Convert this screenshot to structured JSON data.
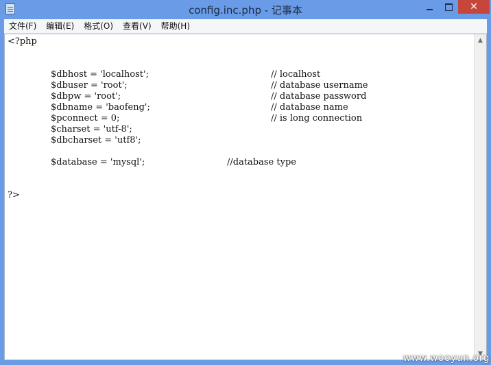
{
  "window": {
    "title": "config.inc.php - 记事本",
    "close_glyph": "✕"
  },
  "menu": [
    {
      "label": "文件(F)"
    },
    {
      "label": "编辑(E)"
    },
    {
      "label": "格式(O)"
    },
    {
      "label": "查看(V)"
    },
    {
      "label": "帮助(H)"
    }
  ],
  "editor": {
    "open_tag": "<?php",
    "lines": [
      {
        "code": "$dbhost = 'localhost';",
        "comment": "// localhost"
      },
      {
        "code": "$dbuser = 'root';",
        "comment": "// database username"
      },
      {
        "code": "$dbpw = 'root';",
        "comment": "// database password"
      },
      {
        "code": "$dbname = 'baofeng';",
        "comment": "// database name"
      },
      {
        "code": "$pconnect = 0;",
        "comment": "// is long connection"
      },
      {
        "code": "$charset = 'utf-8';",
        "comment": ""
      },
      {
        "code": "$dbcharset = 'utf8';",
        "comment": ""
      }
    ],
    "database_line": {
      "code": "$database = 'mysql';",
      "comment": "//database type"
    },
    "close_tag": "?>"
  },
  "watermark": "www.wooyun.org"
}
